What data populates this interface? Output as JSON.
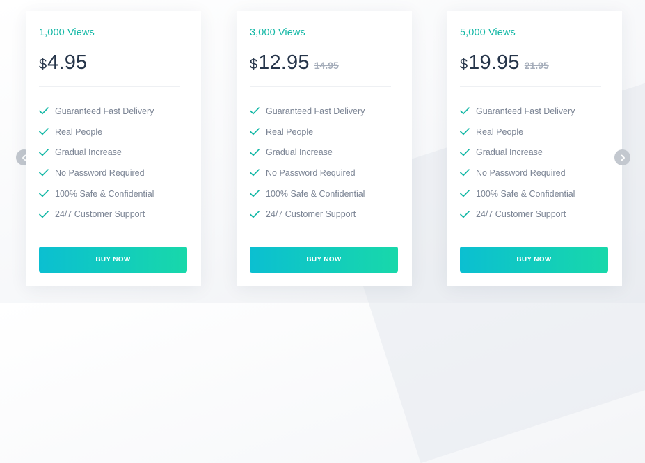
{
  "plans": [
    {
      "name": "1,000 Views",
      "currency": "$",
      "price": "4.95",
      "old_price": "",
      "features": [
        "Guaranteed Fast Delivery",
        "Real People",
        "Gradual Increase",
        "No Password Required",
        "100% Safe & Confidential",
        "24/7 Customer Support"
      ],
      "button_label": "BUY NOW"
    },
    {
      "name": "3,000 Views",
      "currency": "$",
      "price": "12.95",
      "old_price": "14.95",
      "features": [
        "Guaranteed Fast Delivery",
        "Real People",
        "Gradual Increase",
        "No Password Required",
        "100% Safe & Confidential",
        "24/7 Customer Support"
      ],
      "button_label": "BUY NOW"
    },
    {
      "name": "5,000 Views",
      "currency": "$",
      "price": "19.95",
      "old_price": "21.95",
      "features": [
        "Guaranteed Fast Delivery",
        "Real People",
        "Gradual Increase",
        "No Password Required",
        "100% Safe & Confidential",
        "24/7 Customer Support"
      ],
      "button_label": "BUY NOW"
    }
  ],
  "navigation": {
    "previous_icon": "chevron-left-icon",
    "next_icon": "chevron-right-icon"
  },
  "colors": {
    "accent": "#14b8a6",
    "price_text": "#26354a",
    "feature_text": "#7b8494",
    "old_price": "#a5adba",
    "button_gradient_start": "#0bbfd1",
    "button_gradient_end": "#18d8aa",
    "arrow_background": "#c3c8cf"
  }
}
